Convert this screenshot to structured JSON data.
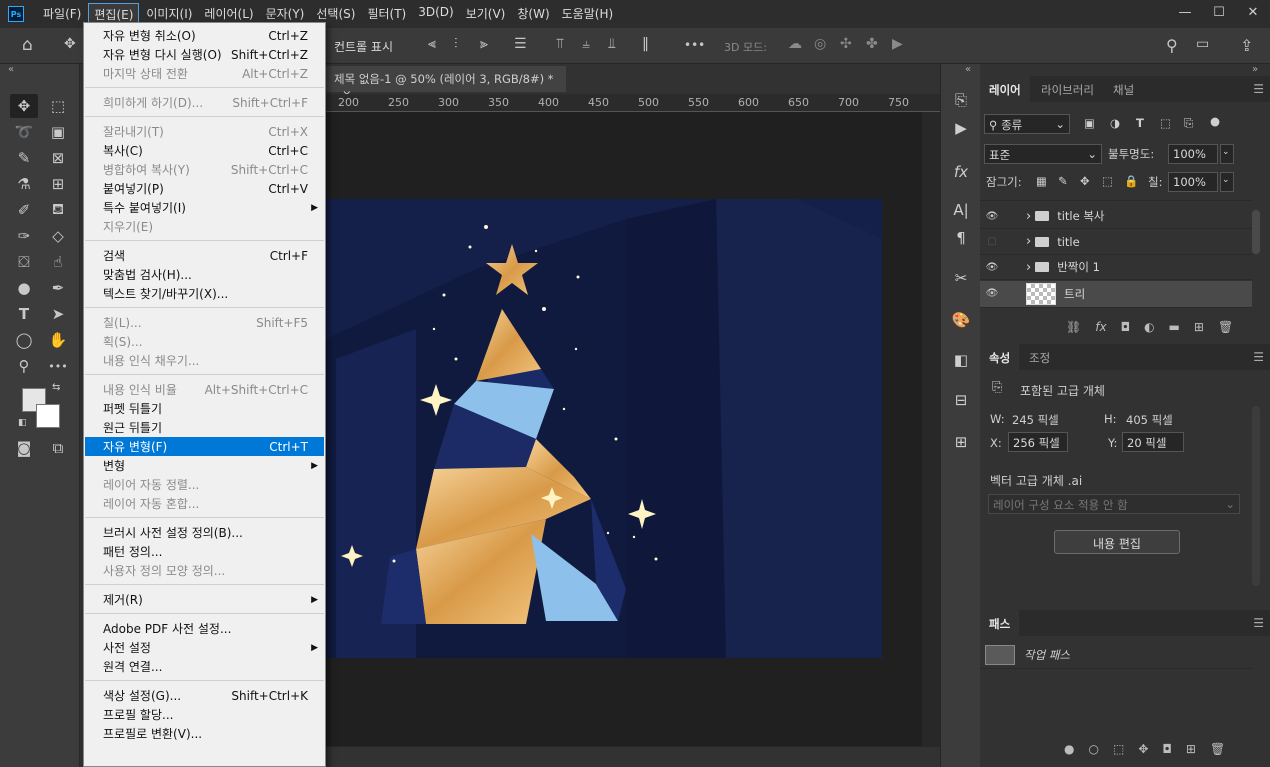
{
  "menubar": {
    "app_logo": "Ps",
    "items": [
      "파일(F)",
      "편집(E)",
      "이미지(I)",
      "레이어(L)",
      "문자(Y)",
      "선택(S)",
      "필터(T)",
      "3D(D)",
      "보기(V)",
      "창(W)",
      "도움말(H)"
    ],
    "active_index": 1
  },
  "window_controls": {
    "minimize": "—",
    "maximize": "☐",
    "close": "✕"
  },
  "optionsbar": {
    "show_controls": "컨트롤 표시",
    "mode_3d": "3D 모드:",
    "more": "•••"
  },
  "document": {
    "tab_title": "제목 없음-1 @ 50% (레이어 3, RGB/8#) *",
    "tab_close": "×",
    "ruler_ticks": [
      "200",
      "250",
      "300",
      "350",
      "400",
      "450",
      "500",
      "550",
      "600",
      "650",
      "700",
      "750"
    ]
  },
  "edit_menu": {
    "groups": [
      [
        {
          "label": "자유 변형 취소(O)",
          "shortcut": "Ctrl+Z",
          "enabled": true
        },
        {
          "label": "자유 변형 다시 실행(O)",
          "shortcut": "Shift+Ctrl+Z",
          "enabled": true
        },
        {
          "label": "마지막 상태 전환",
          "shortcut": "Alt+Ctrl+Z",
          "enabled": false
        }
      ],
      [
        {
          "label": "희미하게 하기(D)...",
          "shortcut": "Shift+Ctrl+F",
          "enabled": false
        }
      ],
      [
        {
          "label": "잘라내기(T)",
          "shortcut": "Ctrl+X",
          "enabled": false
        },
        {
          "label": "복사(C)",
          "shortcut": "Ctrl+C",
          "enabled": true
        },
        {
          "label": "병합하여 복사(Y)",
          "shortcut": "Shift+Ctrl+C",
          "enabled": false
        },
        {
          "label": "붙여넣기(P)",
          "shortcut": "Ctrl+V",
          "enabled": true
        },
        {
          "label": "특수 붙여넣기(I)",
          "shortcut": "",
          "enabled": true,
          "submenu": true
        },
        {
          "label": "지우기(E)",
          "shortcut": "",
          "enabled": false
        }
      ],
      [
        {
          "label": "검색",
          "shortcut": "Ctrl+F",
          "enabled": true
        },
        {
          "label": "맞춤법 검사(H)...",
          "shortcut": "",
          "enabled": true
        },
        {
          "label": "텍스트 찾기/바꾸기(X)...",
          "shortcut": "",
          "enabled": true
        }
      ],
      [
        {
          "label": "칠(L)...",
          "shortcut": "Shift+F5",
          "enabled": false
        },
        {
          "label": "획(S)...",
          "shortcut": "",
          "enabled": false
        },
        {
          "label": "내용 인식 채우기...",
          "shortcut": "",
          "enabled": false
        }
      ],
      [
        {
          "label": "내용 인식 비율",
          "shortcut": "Alt+Shift+Ctrl+C",
          "enabled": false
        },
        {
          "label": "퍼펫 뒤틀기",
          "shortcut": "",
          "enabled": true
        },
        {
          "label": "원근 뒤틀기",
          "shortcut": "",
          "enabled": true
        },
        {
          "label": "자유 변형(F)",
          "shortcut": "Ctrl+T",
          "enabled": true,
          "highlighted": true
        },
        {
          "label": "변형",
          "shortcut": "",
          "enabled": true,
          "submenu": true
        },
        {
          "label": "레이어 자동 정렬...",
          "shortcut": "",
          "enabled": false
        },
        {
          "label": "레이어 자동 혼합...",
          "shortcut": "",
          "enabled": false
        }
      ],
      [
        {
          "label": "브러시 사전 설정 정의(B)...",
          "shortcut": "",
          "enabled": true
        },
        {
          "label": "패턴 정의...",
          "shortcut": "",
          "enabled": true
        },
        {
          "label": "사용자 정의 모양 정의...",
          "shortcut": "",
          "enabled": false
        }
      ],
      [
        {
          "label": "제거(R)",
          "shortcut": "",
          "enabled": true,
          "submenu": true
        }
      ],
      [
        {
          "label": "Adobe PDF 사전 설정...",
          "shortcut": "",
          "enabled": true
        },
        {
          "label": "사전 설정",
          "shortcut": "",
          "enabled": true,
          "submenu": true
        },
        {
          "label": "원격 연결...",
          "shortcut": "",
          "enabled": true
        }
      ],
      [
        {
          "label": "색상 설정(G)...",
          "shortcut": "Shift+Ctrl+K",
          "enabled": true
        },
        {
          "label": "프로필 할당...",
          "shortcut": "",
          "enabled": true
        },
        {
          "label": "프로필로 변환(V)...",
          "shortcut": "",
          "enabled": true
        }
      ]
    ]
  },
  "layers_panel": {
    "tabs": [
      "레이어",
      "라이브러리",
      "채널"
    ],
    "filter_kind": "종류",
    "blend_mode": "표준",
    "opacity_label": "불투명도:",
    "opacity_value": "100%",
    "lock_label": "잠그기:",
    "fill_label": "칠:",
    "fill_value": "100%",
    "layers": [
      {
        "name": "title 복사",
        "type": "group",
        "visible": true
      },
      {
        "name": "title",
        "type": "group",
        "visible": false
      },
      {
        "name": "반짝이 1",
        "type": "group",
        "visible": true
      },
      {
        "name": "트리",
        "type": "smart",
        "visible": true,
        "selected": true
      }
    ]
  },
  "properties_panel": {
    "tabs": [
      "속성",
      "조정"
    ],
    "object_type": "포함된 고급 개체",
    "w_label": "W:",
    "w_value": "245 픽셀",
    "h_label": "H:",
    "h_value": "405 픽셀",
    "x_label": "X:",
    "x_value": "256 픽셀",
    "y_label": "Y:",
    "y_value": "20 픽셀",
    "file_label": "벡터 고급 개체 .ai",
    "layer_comp": "레이어 구성 요소 적용 안 함",
    "edit_contents": "내용 편집"
  },
  "paths_panel": {
    "tab": "패스",
    "paths": [
      "작업 패스"
    ]
  },
  "colors": {
    "accent": "#0078d7",
    "canvas_navy": "#14204a",
    "gold": "#e6b060",
    "ice_blue": "#8ec0ec"
  }
}
